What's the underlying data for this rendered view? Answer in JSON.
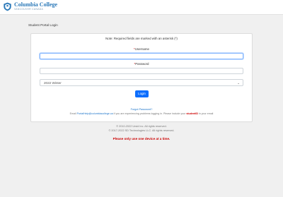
{
  "brand": {
    "name": "Columbia College",
    "tagline": "VANCOUVER CANADA",
    "logo_icon": "columbia-college-logo-icon"
  },
  "page_heading": "Student Portal Login",
  "form": {
    "note": "Note: Required fields are marked with an asterisk (*)",
    "username_label": "Username",
    "password_label": "Password",
    "required_marker": "*",
    "username_value": "",
    "password_value": "",
    "term_selected": "2022 Winter",
    "login_label": "Login",
    "forgot_password": "Forgot Password?",
    "help_prefix": "Email",
    "help_email": "PortalHelp@columbiacollege.ca",
    "help_middle": "if you are experiencing problems logging in. Please include your",
    "help_student_id": "studentID",
    "help_suffix": "in your email"
  },
  "footer": {
    "copyright1": "© 2010-2022 Ursid Inc. All rights reserved.",
    "copyright2": "© 2017-2022 SD Technologies LLC. All rights reserved.",
    "warning": "Please only use one device at a time."
  }
}
